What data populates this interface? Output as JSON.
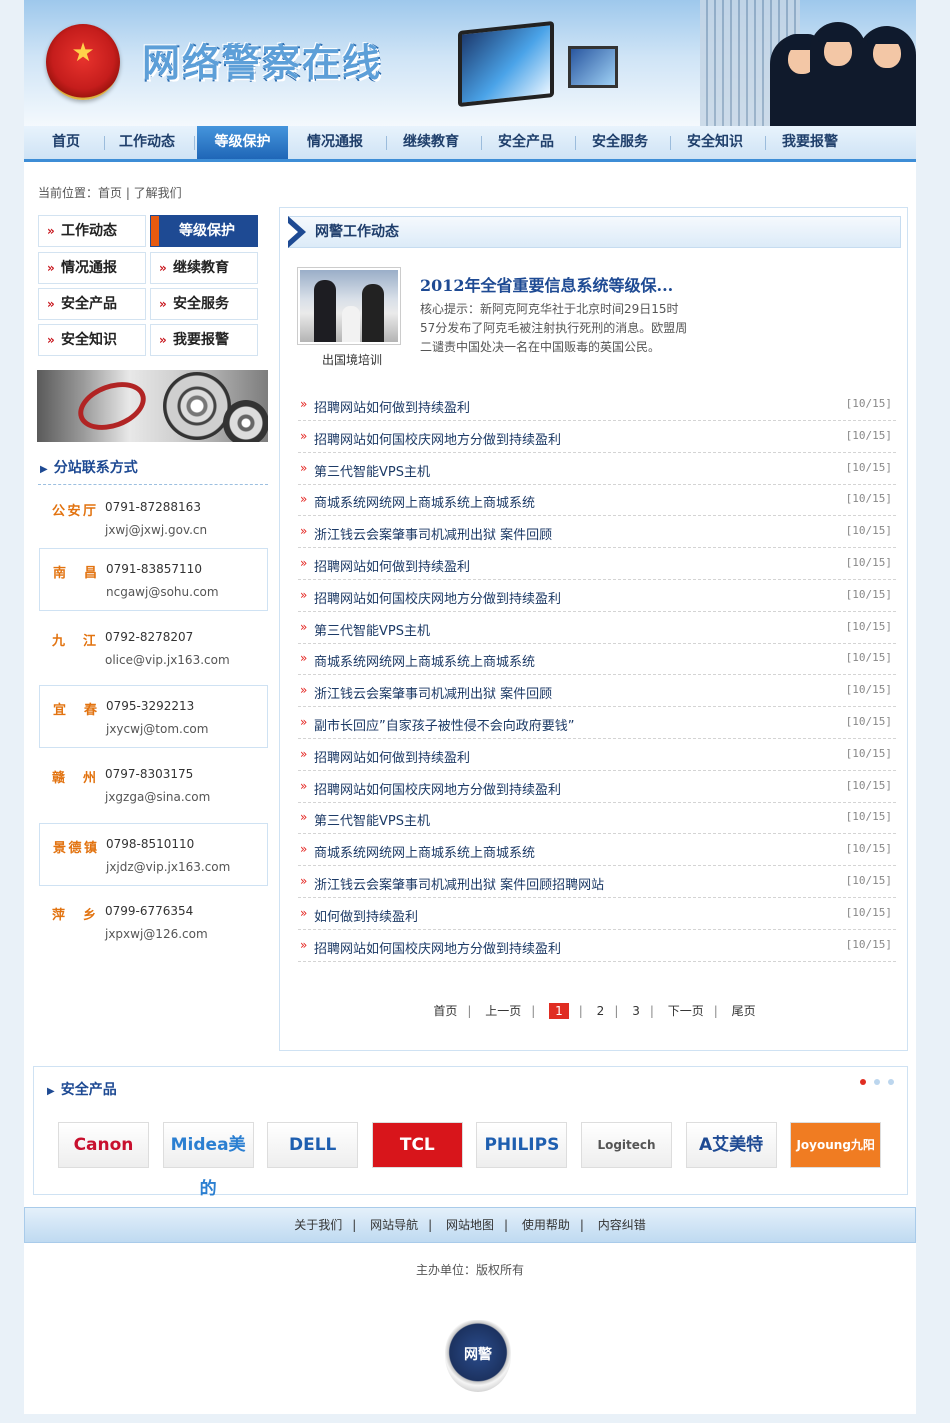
{
  "header": {
    "title": "网络警察在线"
  },
  "nav": [
    "首页",
    "工作动态",
    "等级保护",
    "情况通报",
    "继续教育",
    "安全产品",
    "安全服务",
    "安全知识",
    "我要报警"
  ],
  "breadcrumb": "当前位置：首页 | 了解我们",
  "sidebar": {
    "menu": [
      "工作动态",
      "等级保护",
      "情况通报",
      "继续教育",
      "安全产品",
      "安全服务",
      "安全知识",
      "我要报警"
    ],
    "contact_title": "分站联系方式",
    "contacts": [
      {
        "city": "公安厅",
        "phone": "0791-87288163",
        "email": "jxwj@jxwj.gov.cn"
      },
      {
        "city": "南昌",
        "phone": "0791-83857110",
        "email": "ncgawj@sohu.com"
      },
      {
        "city": "九江",
        "phone": "0792-8278207",
        "email": "olice@vip.jx163.com"
      },
      {
        "city": "宜春",
        "phone": "0795-3292213",
        "email": "jxycwj@tom.com"
      },
      {
        "city": "赣州",
        "phone": "0797-8303175",
        "email": "jxgzga@sina.com"
      },
      {
        "city": "景德镇",
        "phone": "0798-8510110",
        "email": "jxjdz@vip.jx163.com"
      },
      {
        "city": "萍乡",
        "phone": "0799-6776354",
        "email": "jxpxwj@126.com"
      }
    ]
  },
  "main": {
    "heading": "网警工作动态",
    "featured": {
      "title": "2012年全省重要信息系统等级保...",
      "caption": "出国境培训",
      "body": "核心提示：新阿克阿克华社于北京时间29日15时57分发布了阿克毛被注射执行死刑的消息。欧盟周二谴责中国处决一名在中国贩毒的英国公民。"
    },
    "news": [
      {
        "title": "招聘网站如何做到持续盈利",
        "date": "[10/15]"
      },
      {
        "title": "招聘网站如何国校庆网地方分做到持续盈利",
        "date": "[10/15]"
      },
      {
        "title": "第三代智能VPS主机",
        "date": "[10/15]"
      },
      {
        "title": "商城系统网统网上商城系统上商城系统",
        "date": "[10/15]"
      },
      {
        "title": "浙江钱云会案肇事司机减刑出狱 案件回顾",
        "date": "[10/15]"
      },
      {
        "title": "招聘网站如何做到持续盈利",
        "date": "[10/15]"
      },
      {
        "title": "招聘网站如何国校庆网地方分做到持续盈利",
        "date": "[10/15]"
      },
      {
        "title": "第三代智能VPS主机",
        "date": "[10/15]"
      },
      {
        "title": "商城系统网统网上商城系统上商城系统",
        "date": "[10/15]"
      },
      {
        "title": "浙江钱云会案肇事司机减刑出狱 案件回顾",
        "date": "[10/15]"
      },
      {
        "title": "副市长回应”自家孩子被性侵不会向政府要钱”",
        "date": "[10/15]"
      },
      {
        "title": "招聘网站如何做到持续盈利",
        "date": "[10/15]"
      },
      {
        "title": "招聘网站如何国校庆网地方分做到持续盈利",
        "date": "[10/15]"
      },
      {
        "title": "第三代智能VPS主机",
        "date": "[10/15]"
      },
      {
        "title": "商城系统网统网上商城系统上商城系统",
        "date": "[10/15]"
      },
      {
        "title": "浙江钱云会案肇事司机减刑出狱 案件回顾招聘网站",
        "date": "[10/15]"
      },
      {
        "title": "如何做到持续盈利",
        "date": "[10/15]"
      },
      {
        "title": "招聘网站如何国校庆网地方分做到持续盈利",
        "date": "[10/15]"
      }
    ],
    "pager": {
      "first": "首页",
      "prev": "上一页",
      "pages": [
        "1",
        "2",
        "3"
      ],
      "next": "下一页",
      "last": "尾页"
    }
  },
  "partners": {
    "title": "安全产品",
    "logos": [
      {
        "name": "Canon",
        "color": "#c8102e"
      },
      {
        "name": "Midea美的",
        "color": "#2b7fd1"
      },
      {
        "name": "DELL",
        "color": "#1f5fb0"
      },
      {
        "name": "TCL",
        "color": "#ffffff",
        "bg": "#d8151b"
      },
      {
        "name": "PHILIPS",
        "color": "#1f5fb0"
      },
      {
        "name": "Logitech",
        "color": "#555555"
      },
      {
        "name": "A艾美特",
        "color": "#1e4a93"
      },
      {
        "name": "Joyoung九阳",
        "color": "#ffffff",
        "bg": "#f07c22"
      }
    ]
  },
  "footer": {
    "links": [
      "关于我们",
      "网站导航",
      "网站地图",
      "使用帮助",
      "内容纠错"
    ],
    "copyright": "主办单位：版权所有",
    "badge": "网警"
  }
}
